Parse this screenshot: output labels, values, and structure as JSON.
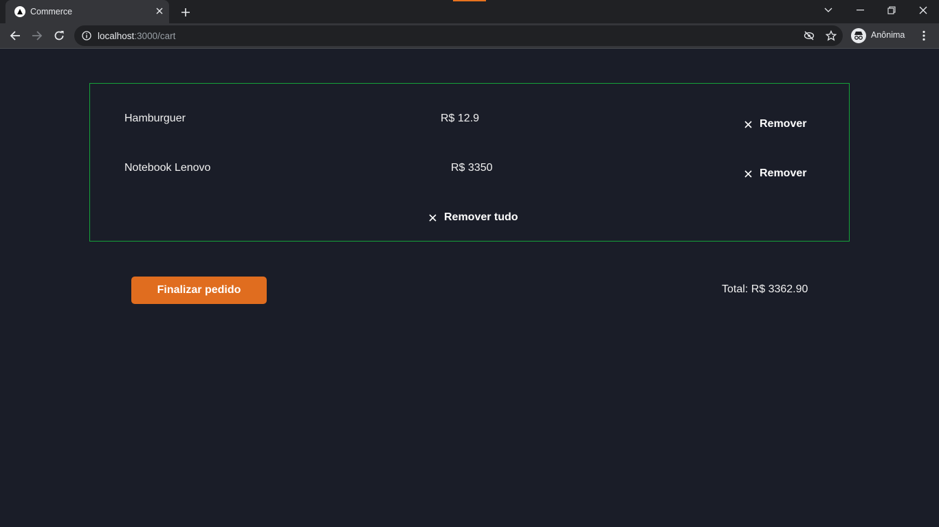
{
  "browser": {
    "tab_title": "Commerce",
    "url_host": "localhost",
    "url_rest": ":3000/cart",
    "profile_name": "Anônima"
  },
  "cart": {
    "items": [
      {
        "name": "Hamburguer",
        "price": "R$ 12.9",
        "remove_label": "Remover"
      },
      {
        "name": "Notebook Lenovo",
        "price": "R$ 3350",
        "remove_label": "Remover"
      }
    ],
    "remove_all_label": "Remover tudo"
  },
  "checkout": {
    "button_label": "Finalizar pedido",
    "total_text": "Total: R$ 3362.90"
  },
  "colors": {
    "background": "#1a1d28",
    "border_accent": "#15a33a",
    "button": "#e06d1f"
  }
}
